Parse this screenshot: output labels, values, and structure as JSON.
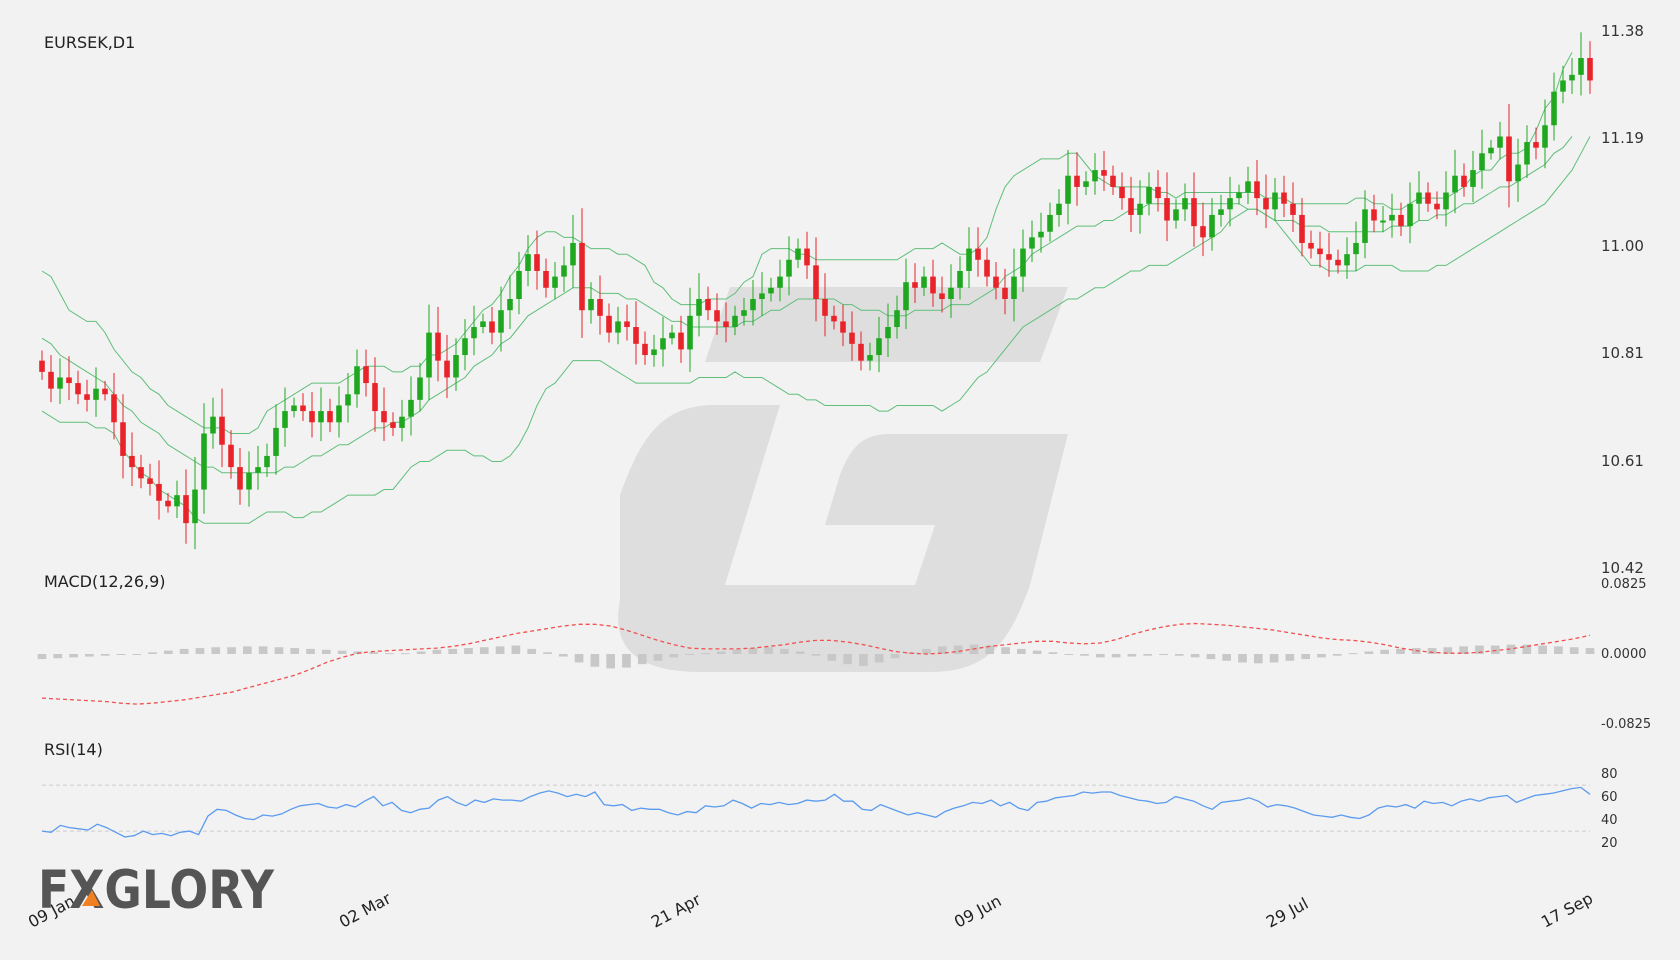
{
  "chart_data": [
    {
      "type": "candlestick",
      "title": "EURSEK,D1",
      "ylim": [
        10.42,
        11.38
      ],
      "y_ticks": [
        "11.38",
        "11.19",
        "11.00",
        "10.81",
        "10.61",
        "10.42"
      ],
      "x_ticks": [
        "09 Jan",
        "02 Mar",
        "21 Apr",
        "09 Jun",
        "29 Jul",
        "17 Sep"
      ],
      "close": [
        10.77,
        10.74,
        10.76,
        10.75,
        10.73,
        10.72,
        10.74,
        10.73,
        10.68,
        10.62,
        10.6,
        10.58,
        10.57,
        10.54,
        10.53,
        10.55,
        10.5,
        10.56,
        10.66,
        10.69,
        10.64,
        10.6,
        10.56,
        10.59,
        10.6,
        10.62,
        10.67,
        10.7,
        10.71,
        10.7,
        10.68,
        10.7,
        10.68,
        10.71,
        10.73,
        10.78,
        10.75,
        10.7,
        10.68,
        10.67,
        10.69,
        10.72,
        10.76,
        10.84,
        10.79,
        10.76,
        10.8,
        10.83,
        10.85,
        10.86,
        10.84,
        10.88,
        10.9,
        10.95,
        10.98,
        10.95,
        10.92,
        10.94,
        10.96,
        11.0,
        10.88,
        10.9,
        10.87,
        10.84,
        10.86,
        10.85,
        10.82,
        10.8,
        10.81,
        10.83,
        10.84,
        10.81,
        10.87,
        10.9,
        10.88,
        10.86,
        10.85,
        10.87,
        10.88,
        10.9,
        10.91,
        10.92,
        10.94,
        10.97,
        10.99,
        10.96,
        10.9,
        10.87,
        10.86,
        10.84,
        10.82,
        10.79,
        10.8,
        10.83,
        10.85,
        10.88,
        10.93,
        10.92,
        10.94,
        10.91,
        10.9,
        10.92,
        10.95,
        10.99,
        10.97,
        10.94,
        10.92,
        10.9,
        10.94,
        10.99,
        11.01,
        11.02,
        11.05,
        11.07,
        11.12,
        11.1,
        11.11,
        11.13,
        11.12,
        11.1,
        11.08,
        11.05,
        11.07,
        11.1,
        11.08,
        11.04,
        11.06,
        11.08,
        11.03,
        11.01,
        11.05,
        11.06,
        11.08,
        11.09,
        11.11,
        11.08,
        11.06,
        11.09,
        11.07,
        11.05,
        11.0,
        10.99,
        10.98,
        10.97,
        10.96,
        10.98,
        11.0,
        11.06,
        11.04,
        11.04,
        11.05,
        11.03,
        11.07,
        11.09,
        11.07,
        11.06,
        11.09,
        11.12,
        11.1,
        11.13,
        11.16,
        11.17,
        11.19,
        11.11,
        11.14,
        11.18,
        11.17,
        11.21,
        11.27,
        11.29,
        11.3,
        11.33,
        11.29
      ],
      "bollinger": {
        "upper": [
          10.95,
          10.94,
          10.91,
          10.88,
          10.87,
          10.86,
          10.86,
          10.84,
          10.81,
          10.79,
          10.77,
          10.76,
          10.74,
          10.73,
          10.71,
          10.7,
          10.69,
          10.68,
          10.67,
          10.67,
          10.67,
          10.66,
          10.66,
          10.66,
          10.67,
          10.7,
          10.71,
          10.72,
          10.73,
          10.74,
          10.75,
          10.75,
          10.75,
          10.75,
          10.76,
          10.77,
          10.78,
          10.78,
          10.78,
          10.77,
          10.77,
          10.78,
          10.78,
          10.8,
          10.8,
          10.81,
          10.82,
          10.84,
          10.86,
          10.88,
          10.89,
          10.91,
          10.94,
          10.96,
          10.99,
          11.01,
          11.02,
          11.02,
          11.01,
          11.01,
          11.0,
          10.99,
          10.99,
          10.99,
          10.98,
          10.98,
          10.97,
          10.96,
          10.93,
          10.92,
          10.9,
          10.89,
          10.89,
          10.89,
          10.9,
          10.9,
          10.9,
          10.91,
          10.93,
          10.94,
          10.98,
          10.99,
          10.99,
          10.99,
          10.98,
          10.98,
          10.97,
          10.97,
          10.97,
          10.97,
          10.97,
          10.97,
          10.97,
          10.97,
          10.97,
          10.97,
          10.98,
          10.99,
          10.99,
          10.99,
          11.0,
          10.99,
          10.98,
          10.98,
          10.99,
          11.01,
          11.06,
          11.1,
          11.12,
          11.13,
          11.14,
          11.15,
          11.15,
          11.15,
          11.16,
          11.16,
          11.14,
          11.12,
          11.11,
          11.1,
          11.1,
          11.1,
          11.1,
          11.1,
          11.09,
          11.09,
          11.08,
          11.09,
          11.09,
          11.09,
          11.09,
          11.09,
          11.09,
          11.09,
          11.09,
          11.09,
          11.08,
          11.08,
          11.08,
          11.07,
          11.07,
          11.07,
          11.07,
          11.07,
          11.07,
          11.07,
          11.08,
          11.08,
          11.07,
          11.07,
          11.06,
          11.06,
          11.07,
          11.08,
          11.08,
          11.08,
          11.08,
          11.09,
          11.1,
          11.12,
          11.13,
          11.13,
          11.15,
          11.16,
          11.16,
          11.17,
          11.2,
          11.24,
          11.26,
          11.31,
          11.34
        ],
        "middle": [
          10.83,
          10.82,
          10.8,
          10.79,
          10.78,
          10.77,
          10.76,
          10.75,
          10.73,
          10.71,
          10.7,
          10.68,
          10.67,
          10.66,
          10.64,
          10.63,
          10.62,
          10.61,
          10.6,
          10.6,
          10.59,
          10.59,
          10.59,
          10.59,
          10.59,
          10.59,
          10.59,
          10.6,
          10.6,
          10.61,
          10.62,
          10.62,
          10.63,
          10.64,
          10.64,
          10.65,
          10.66,
          10.67,
          10.67,
          10.68,
          10.68,
          10.69,
          10.7,
          10.72,
          10.73,
          10.74,
          10.75,
          10.76,
          10.78,
          10.79,
          10.8,
          10.82,
          10.83,
          10.85,
          10.87,
          10.88,
          10.89,
          10.9,
          10.91,
          10.92,
          10.92,
          10.92,
          10.91,
          10.91,
          10.91,
          10.9,
          10.9,
          10.89,
          10.88,
          10.87,
          10.86,
          10.86,
          10.85,
          10.85,
          10.85,
          10.85,
          10.85,
          10.85,
          10.86,
          10.86,
          10.87,
          10.88,
          10.88,
          10.89,
          10.9,
          10.9,
          10.9,
          10.9,
          10.9,
          10.89,
          10.89,
          10.88,
          10.88,
          10.88,
          10.87,
          10.87,
          10.87,
          10.88,
          10.88,
          10.88,
          10.88,
          10.89,
          10.89,
          10.89,
          10.9,
          10.91,
          10.92,
          10.94,
          10.95,
          10.96,
          10.98,
          10.99,
          11.0,
          11.01,
          11.02,
          11.03,
          11.03,
          11.03,
          11.04,
          11.04,
          11.05,
          11.06,
          11.06,
          11.07,
          11.07,
          11.07,
          11.07,
          11.07,
          11.07,
          11.07,
          11.07,
          11.07,
          11.07,
          11.07,
          11.06,
          11.06,
          11.05,
          11.04,
          11.04,
          11.04,
          11.03,
          11.03,
          11.03,
          11.02,
          11.02,
          11.02,
          11.02,
          11.02,
          11.02,
          11.02,
          11.03,
          11.03,
          11.03,
          11.04,
          11.04,
          11.05,
          11.05,
          11.06,
          11.07,
          11.07,
          11.08,
          11.09,
          11.1,
          11.1,
          11.11,
          11.12,
          11.13,
          11.14,
          11.16,
          11.17,
          11.19
        ],
        "lower": [
          10.7,
          10.69,
          10.68,
          10.68,
          10.68,
          10.68,
          10.67,
          10.67,
          10.66,
          10.63,
          10.61,
          10.59,
          10.58,
          10.56,
          10.55,
          10.54,
          10.53,
          10.51,
          10.5,
          10.5,
          10.5,
          10.5,
          10.5,
          10.5,
          10.51,
          10.52,
          10.52,
          10.52,
          10.51,
          10.51,
          10.52,
          10.52,
          10.53,
          10.54,
          10.55,
          10.55,
          10.55,
          10.55,
          10.56,
          10.56,
          10.58,
          10.6,
          10.61,
          10.61,
          10.62,
          10.63,
          10.63,
          10.63,
          10.62,
          10.62,
          10.61,
          10.61,
          10.62,
          10.64,
          10.67,
          10.71,
          10.74,
          10.75,
          10.77,
          10.79,
          10.79,
          10.79,
          10.79,
          10.78,
          10.77,
          10.76,
          10.75,
          10.75,
          10.75,
          10.75,
          10.75,
          10.75,
          10.75,
          10.76,
          10.76,
          10.76,
          10.76,
          10.77,
          10.76,
          10.76,
          10.76,
          10.75,
          10.74,
          10.73,
          10.73,
          10.72,
          10.72,
          10.71,
          10.71,
          10.71,
          10.71,
          10.71,
          10.71,
          10.7,
          10.7,
          10.71,
          10.71,
          10.71,
          10.71,
          10.71,
          10.7,
          10.71,
          10.72,
          10.74,
          10.76,
          10.77,
          10.79,
          10.81,
          10.83,
          10.85,
          10.86,
          10.87,
          10.88,
          10.89,
          10.9,
          10.9,
          10.91,
          10.92,
          10.92,
          10.93,
          10.94,
          10.95,
          10.95,
          10.96,
          10.96,
          10.96,
          10.97,
          10.98,
          10.99,
          11.0,
          11.01,
          11.02,
          11.04,
          11.05,
          11.06,
          11.06,
          11.05,
          11.04,
          11.02,
          11.0,
          10.98,
          10.96,
          10.96,
          10.95,
          10.95,
          10.95,
          10.95,
          10.96,
          10.96,
          10.96,
          10.96,
          10.95,
          10.95,
          10.95,
          10.95,
          10.96,
          10.96,
          10.97,
          10.98,
          10.99,
          11.0,
          11.01,
          11.02,
          11.03,
          11.04,
          11.05,
          11.06,
          11.07,
          11.09,
          11.11,
          11.13,
          11.16,
          11.19
        ]
      },
      "candle_colors": {
        "up": "#1fa81f",
        "down": "#e8232a"
      },
      "band_color": "#5fbf7a"
    },
    {
      "type": "macd",
      "title": "MACD(12,26,9)",
      "ylim": [
        -0.0825,
        0.0825
      ],
      "y_ticks": [
        "0.0825",
        "0.0000",
        "-0.0825"
      ],
      "signal": [
        -0.052,
        -0.053,
        -0.054,
        -0.055,
        -0.056,
        -0.058,
        -0.059,
        -0.058,
        -0.056,
        -0.054,
        -0.051,
        -0.048,
        -0.045,
        -0.04,
        -0.035,
        -0.03,
        -0.025,
        -0.018,
        -0.01,
        -0.004,
        0.001,
        0.003,
        0.004,
        0.005,
        0.006,
        0.007,
        0.009,
        0.012,
        0.016,
        0.02,
        0.024,
        0.027,
        0.03,
        0.033,
        0.035,
        0.035,
        0.033,
        0.028,
        0.022,
        0.016,
        0.011,
        0.007,
        0.006,
        0.006,
        0.006,
        0.007,
        0.009,
        0.011,
        0.014,
        0.016,
        0.016,
        0.014,
        0.011,
        0.007,
        0.003,
        0.001,
        0.0,
        0.001,
        0.003,
        0.006,
        0.009,
        0.011,
        0.013,
        0.015,
        0.015,
        0.013,
        0.012,
        0.013,
        0.017,
        0.023,
        0.028,
        0.032,
        0.035,
        0.036,
        0.035,
        0.034,
        0.032,
        0.03,
        0.028,
        0.025,
        0.022,
        0.019,
        0.017,
        0.016,
        0.014,
        0.011,
        0.007,
        0.004,
        0.002,
        0.001,
        0.001,
        0.002,
        0.004,
        0.006,
        0.009,
        0.012,
        0.015,
        0.018,
        0.022
      ],
      "histogram": [
        -0.006,
        -0.005,
        -0.004,
        -0.003,
        -0.002,
        -0.001,
        0.0,
        0.002,
        0.004,
        0.006,
        0.007,
        0.008,
        0.008,
        0.009,
        0.009,
        0.008,
        0.007,
        0.006,
        0.005,
        0.004,
        0.003,
        0.002,
        0.001,
        0.001,
        0.003,
        0.005,
        0.006,
        0.007,
        0.008,
        0.009,
        0.01,
        0.006,
        0.002,
        -0.003,
        -0.01,
        -0.015,
        -0.017,
        -0.016,
        -0.012,
        -0.008,
        -0.004,
        -0.001,
        0.001,
        0.003,
        0.005,
        0.007,
        0.008,
        0.006,
        0.003,
        -0.002,
        -0.008,
        -0.012,
        -0.014,
        -0.01,
        -0.005,
        0.002,
        0.006,
        0.009,
        0.01,
        0.011,
        0.01,
        0.008,
        0.006,
        0.004,
        0.002,
        0.0,
        -0.002,
        -0.004,
        -0.004,
        -0.003,
        -0.002,
        -0.001,
        -0.002,
        -0.004,
        -0.006,
        -0.008,
        -0.01,
        -0.011,
        -0.01,
        -0.008,
        -0.006,
        -0.004,
        -0.002,
        0.001,
        0.003,
        0.005,
        0.006,
        0.007,
        0.007,
        0.008,
        0.009,
        0.01,
        0.01,
        0.011,
        0.011,
        0.01,
        0.009,
        0.008,
        0.007
      ],
      "signal_color": "#f0504f",
      "histogram_color": "#c8c8c8"
    },
    {
      "type": "line",
      "title": "RSI(14)",
      "ylim": [
        15,
        85
      ],
      "y_ticks": [
        "80",
        "60",
        "40",
        "20"
      ],
      "levels": [
        70,
        30
      ],
      "values": [
        30,
        29,
        35,
        33,
        32,
        31,
        36,
        33,
        29,
        25,
        26,
        30,
        27,
        28,
        26,
        29,
        30,
        27,
        43,
        49,
        48,
        44,
        41,
        40,
        44,
        43,
        45,
        49,
        52,
        53,
        54,
        51,
        50,
        53,
        51,
        56,
        60,
        52,
        55,
        48,
        46,
        49,
        50,
        57,
        60,
        55,
        52,
        57,
        55,
        58,
        57,
        57,
        56,
        60,
        63,
        65,
        63,
        60,
        62,
        60,
        64,
        53,
        52,
        53,
        48,
        50,
        49,
        49,
        46,
        44,
        47,
        46,
        52,
        51,
        52,
        57,
        54,
        50,
        54,
        53,
        55,
        53,
        54,
        57,
        56,
        57,
        62,
        56,
        56,
        49,
        48,
        53,
        50,
        47,
        44,
        46,
        44,
        42,
        47,
        50,
        52,
        55,
        54,
        57,
        52,
        55,
        50,
        48,
        55,
        56,
        59,
        60,
        61,
        64,
        63,
        64,
        64,
        61,
        59,
        57,
        56,
        54,
        55,
        60,
        58,
        56,
        52,
        49,
        55,
        56,
        57,
        59,
        56,
        51,
        53,
        52,
        50,
        47,
        44,
        43,
        42,
        44,
        42,
        41,
        44,
        50,
        52,
        51,
        53,
        50,
        56,
        54,
        55,
        52,
        56,
        58,
        56,
        59,
        60,
        61,
        55,
        58,
        61,
        62,
        63,
        65,
        67,
        68,
        62
      ],
      "line_color": "#5b9bef",
      "level_color": "#cccccc"
    }
  ],
  "logo": {
    "text": "FXGLORY"
  }
}
